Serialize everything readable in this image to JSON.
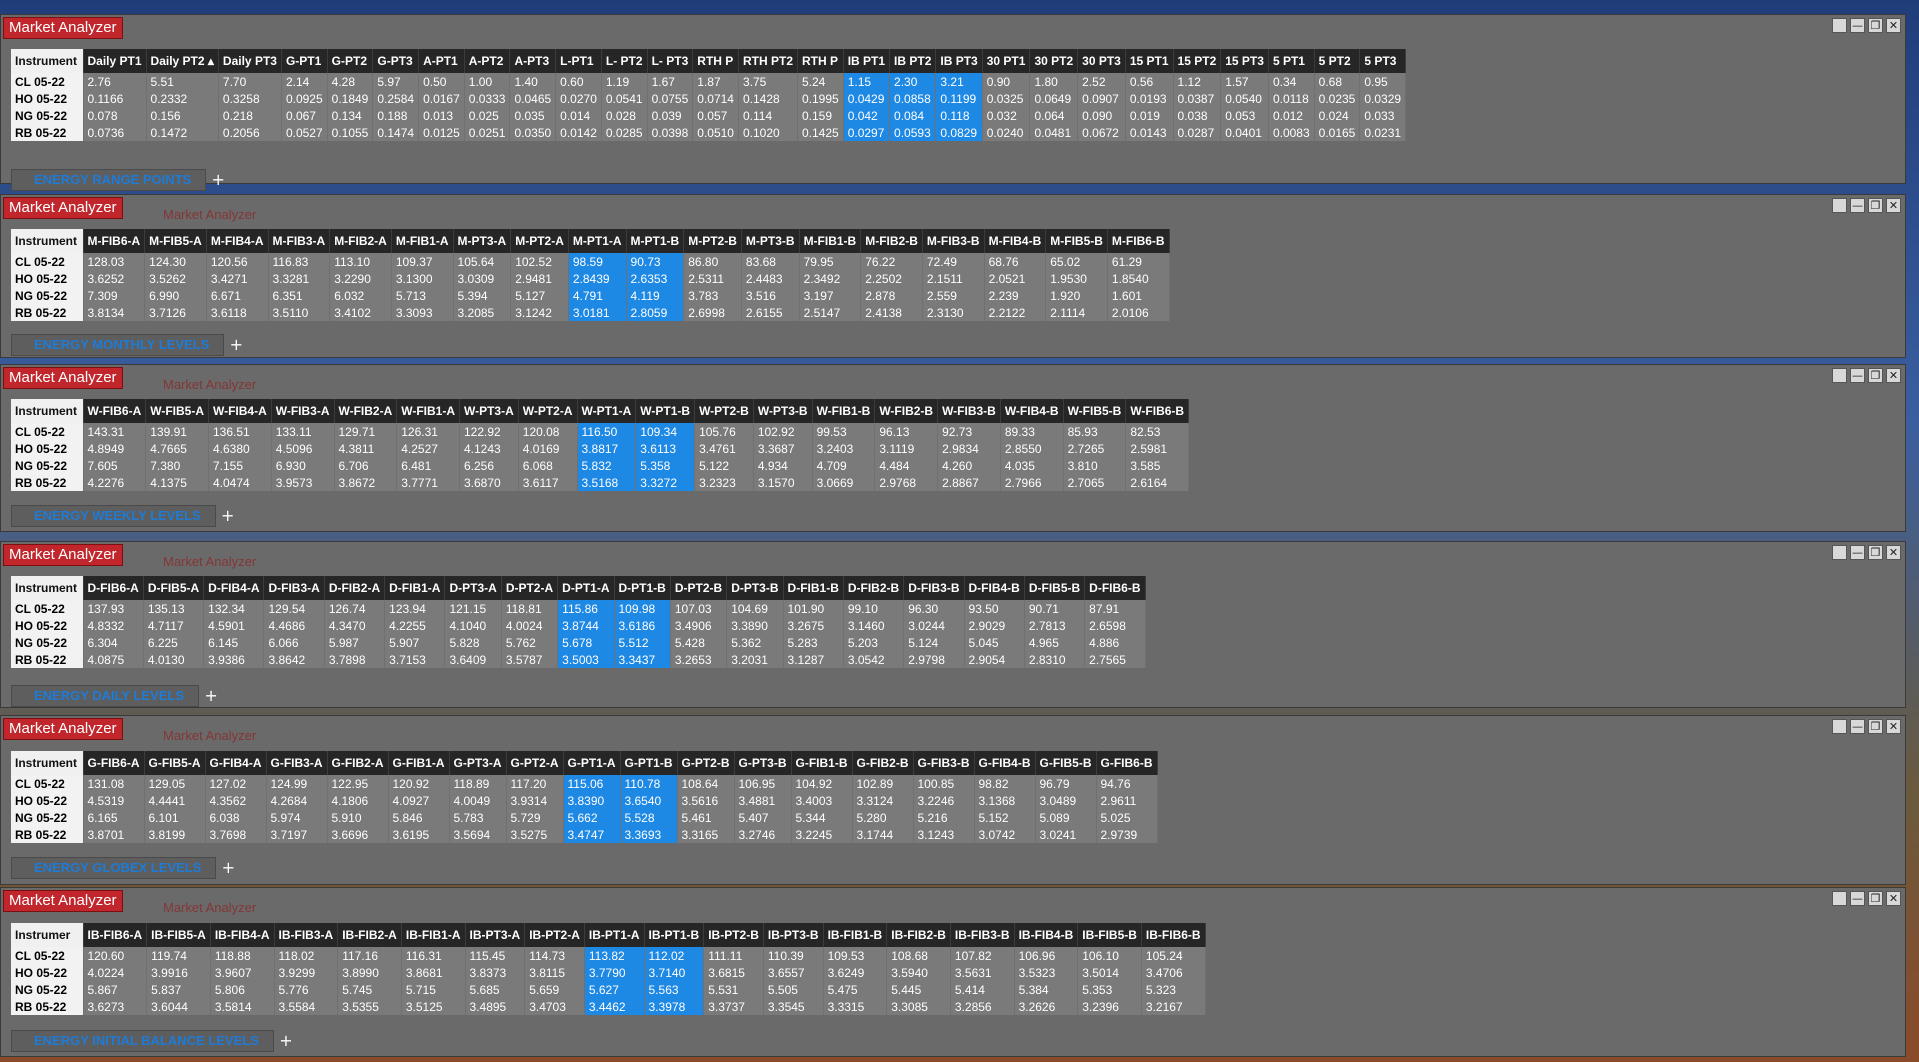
{
  "app": {
    "title": "Market Analyzer",
    "win_buttons": [
      "",
      "—",
      "❐",
      "✕"
    ]
  },
  "instruments": [
    "CL 05-22",
    "HO 05-22",
    "NG 05-22",
    "RB 05-22"
  ],
  "windows": [
    {
      "id": "range",
      "tab": "ENERGY RANGE POINTS",
      "instrument_header": "Instrument",
      "columns": [
        "Daily PT1",
        "Daily PT2 ▴",
        "Daily PT3",
        "G-PT1",
        "G-PT2",
        "G-PT3",
        "A-PT1",
        "A-PT2",
        "A-PT3",
        "L-PT1",
        "L- PT2",
        "L- PT3",
        "RTH P",
        "RTH PT2",
        "RTH P",
        "IB PT1",
        "IB PT2",
        "IB PT3",
        "30 PT1",
        "30 PT2",
        "30 PT3",
        "15 PT1",
        "15 PT2",
        "15 PT3",
        "5 PT1",
        "5 PT2",
        "5 PT3"
      ],
      "highlight": [
        15,
        16,
        17
      ],
      "rows": [
        [
          "2.76",
          "5.51",
          "7.70",
          "2.14",
          "4.28",
          "5.97",
          "0.50",
          "1.00",
          "1.40",
          "0.60",
          "1.19",
          "1.67",
          "1.87",
          "3.75",
          "5.24",
          "1.15",
          "2.30",
          "3.21",
          "0.90",
          "1.80",
          "2.52",
          "0.56",
          "1.12",
          "1.57",
          "0.34",
          "0.68",
          "0.95"
        ],
        [
          "0.1166",
          "0.2332",
          "0.3258",
          "0.0925",
          "0.1849",
          "0.2584",
          "0.0167",
          "0.0333",
          "0.0465",
          "0.0270",
          "0.0541",
          "0.0755",
          "0.0714",
          "0.1428",
          "0.1995",
          "0.0429",
          "0.0858",
          "0.1199",
          "0.0325",
          "0.0649",
          "0.0907",
          "0.0193",
          "0.0387",
          "0.0540",
          "0.0118",
          "0.0235",
          "0.0329"
        ],
        [
          "0.078",
          "0.156",
          "0.218",
          "0.067",
          "0.134",
          "0.188",
          "0.013",
          "0.025",
          "0.035",
          "0.014",
          "0.028",
          "0.039",
          "0.057",
          "0.114",
          "0.159",
          "0.042",
          "0.084",
          "0.118",
          "0.032",
          "0.064",
          "0.090",
          "0.019",
          "0.038",
          "0.053",
          "0.012",
          "0.024",
          "0.033"
        ],
        [
          "0.0736",
          "0.1472",
          "0.2056",
          "0.0527",
          "0.1055",
          "0.1474",
          "0.0125",
          "0.0251",
          "0.0350",
          "0.0142",
          "0.0285",
          "0.0398",
          "0.0510",
          "0.1020",
          "0.1425",
          "0.0297",
          "0.0593",
          "0.0829",
          "0.0240",
          "0.0481",
          "0.0672",
          "0.0143",
          "0.0287",
          "0.0401",
          "0.0083",
          "0.0165",
          "0.0231"
        ]
      ]
    },
    {
      "id": "monthly",
      "tab": "ENERGY MONTHLY LEVELS",
      "instrument_header": "Instrument",
      "columns": [
        "M-FIB6-A",
        "M-FIB5-A",
        "M-FIB4-A",
        "M-FIB3-A",
        "M-FIB2-A",
        "M-FIB1-A",
        "M-PT3-A",
        "M-PT2-A",
        "M-PT1-A",
        "M-PT1-B",
        "M-PT2-B",
        "M-PT3-B",
        "M-FIB1-B",
        "M-FIB2-B",
        "M-FIB3-B",
        "M-FIB4-B",
        "M-FIB5-B",
        "M-FIB6-B"
      ],
      "highlight": [
        8,
        9
      ],
      "rows": [
        [
          "128.03",
          "124.30",
          "120.56",
          "116.83",
          "113.10",
          "109.37",
          "105.64",
          "102.52",
          "98.59",
          "90.73",
          "86.80",
          "83.68",
          "79.95",
          "76.22",
          "72.49",
          "68.76",
          "65.02",
          "61.29"
        ],
        [
          "3.6252",
          "3.5262",
          "3.4271",
          "3.3281",
          "3.2290",
          "3.1300",
          "3.0309",
          "2.9481",
          "2.8439",
          "2.6353",
          "2.5311",
          "2.4483",
          "2.3492",
          "2.2502",
          "2.1511",
          "2.0521",
          "1.9530",
          "1.8540"
        ],
        [
          "7.309",
          "6.990",
          "6.671",
          "6.351",
          "6.032",
          "5.713",
          "5.394",
          "5.127",
          "4.791",
          "4.119",
          "3.783",
          "3.516",
          "3.197",
          "2.878",
          "2.559",
          "2.239",
          "1.920",
          "1.601"
        ],
        [
          "3.8134",
          "3.7126",
          "3.6118",
          "3.5110",
          "3.4102",
          "3.3093",
          "3.2085",
          "3.1242",
          "3.0181",
          "2.8059",
          "2.6998",
          "2.6155",
          "2.5147",
          "2.4138",
          "2.3130",
          "2.2122",
          "2.1114",
          "2.0106"
        ]
      ]
    },
    {
      "id": "weekly",
      "tab": "ENERGY WEEKLY LEVELS",
      "instrument_header": "Instrument",
      "columns": [
        "W-FIB6-A",
        "W-FIB5-A",
        "W-FIB4-A",
        "W-FIB3-A",
        "W-FIB2-A",
        "W-FIB1-A",
        "W-PT3-A",
        "W-PT2-A",
        "W-PT1-A",
        "W-PT1-B",
        "W-PT2-B",
        "W-PT3-B",
        "W-FIB1-B",
        "W-FIB2-B",
        "W-FIB3-B",
        "W-FIB4-B",
        "W-FIB5-B",
        "W-FIB6-B"
      ],
      "highlight": [
        8,
        9
      ],
      "rows": [
        [
          "143.31",
          "139.91",
          "136.51",
          "133.11",
          "129.71",
          "126.31",
          "122.92",
          "120.08",
          "116.50",
          "109.34",
          "105.76",
          "102.92",
          "99.53",
          "96.13",
          "92.73",
          "89.33",
          "85.93",
          "82.53"
        ],
        [
          "4.8949",
          "4.7665",
          "4.6380",
          "4.5096",
          "4.3811",
          "4.2527",
          "4.1243",
          "4.0169",
          "3.8817",
          "3.6113",
          "3.4761",
          "3.3687",
          "3.2403",
          "3.1119",
          "2.9834",
          "2.8550",
          "2.7265",
          "2.5981"
        ],
        [
          "7.605",
          "7.380",
          "7.155",
          "6.930",
          "6.706",
          "6.481",
          "6.256",
          "6.068",
          "5.832",
          "5.358",
          "5.122",
          "4.934",
          "4.709",
          "4.484",
          "4.260",
          "4.035",
          "3.810",
          "3.585"
        ],
        [
          "4.2276",
          "4.1375",
          "4.0474",
          "3.9573",
          "3.8672",
          "3.7771",
          "3.6870",
          "3.6117",
          "3.5168",
          "3.3272",
          "3.2323",
          "3.1570",
          "3.0669",
          "2.9768",
          "2.8867",
          "2.7966",
          "2.7065",
          "2.6164"
        ]
      ]
    },
    {
      "id": "daily",
      "tab": "ENERGY DAILY LEVELS",
      "instrument_header": "Instrument",
      "columns": [
        "D-FIB6-A",
        "D-FIB5-A",
        "D-FIB4-A",
        "D-FIB3-A",
        "D-FIB2-A",
        "D-FIB1-A",
        "D-PT3-A",
        "D-PT2-A",
        "D-PT1-A",
        "D-PT1-B",
        "D-PT2-B",
        "D-PT3-B",
        "D-FIB1-B",
        "D-FIB2-B",
        "D-FIB3-B",
        "D-FIB4-B",
        "D-FIB5-B",
        "D-FIB6-B"
      ],
      "highlight": [
        8,
        9
      ],
      "rows": [
        [
          "137.93",
          "135.13",
          "132.34",
          "129.54",
          "126.74",
          "123.94",
          "121.15",
          "118.81",
          "115.86",
          "109.98",
          "107.03",
          "104.69",
          "101.90",
          "99.10",
          "96.30",
          "93.50",
          "90.71",
          "87.91"
        ],
        [
          "4.8332",
          "4.7117",
          "4.5901",
          "4.4686",
          "4.3470",
          "4.2255",
          "4.1040",
          "4.0024",
          "3.8744",
          "3.6186",
          "3.4906",
          "3.3890",
          "3.2675",
          "3.1460",
          "3.0244",
          "2.9029",
          "2.7813",
          "2.6598"
        ],
        [
          "6.304",
          "6.225",
          "6.145",
          "6.066",
          "5.987",
          "5.907",
          "5.828",
          "5.762",
          "5.678",
          "5.512",
          "5.428",
          "5.362",
          "5.283",
          "5.203",
          "5.124",
          "5.045",
          "4.965",
          "4.886"
        ],
        [
          "4.0875",
          "4.0130",
          "3.9386",
          "3.8642",
          "3.7898",
          "3.7153",
          "3.6409",
          "3.5787",
          "3.5003",
          "3.3437",
          "3.2653",
          "3.2031",
          "3.1287",
          "3.0542",
          "2.9798",
          "2.9054",
          "2.8310",
          "2.7565"
        ]
      ]
    },
    {
      "id": "globex",
      "tab": "ENERGY GLOBEX LEVELS",
      "instrument_header": "Instrument",
      "columns": [
        "G-FIB6-A",
        "G-FIB5-A",
        "G-FIB4-A",
        "G-FIB3-A",
        "G-FIB2-A",
        "G-FIB1-A",
        "G-PT3-A",
        "G-PT2-A",
        "G-PT1-A",
        "G-PT1-B",
        "G-PT2-B",
        "G-PT3-B",
        "G-FIB1-B",
        "G-FIB2-B",
        "G-FIB3-B",
        "G-FIB4-B",
        "G-FIB5-B",
        "G-FIB6-B"
      ],
      "highlight": [
        8,
        9
      ],
      "rows": [
        [
          "131.08",
          "129.05",
          "127.02",
          "124.99",
          "122.95",
          "120.92",
          "118.89",
          "117.20",
          "115.06",
          "110.78",
          "108.64",
          "106.95",
          "104.92",
          "102.89",
          "100.85",
          "98.82",
          "96.79",
          "94.76"
        ],
        [
          "4.5319",
          "4.4441",
          "4.3562",
          "4.2684",
          "4.1806",
          "4.0927",
          "4.0049",
          "3.9314",
          "3.8390",
          "3.6540",
          "3.5616",
          "3.4881",
          "3.4003",
          "3.3124",
          "3.2246",
          "3.1368",
          "3.0489",
          "2.9611"
        ],
        [
          "6.165",
          "6.101",
          "6.038",
          "5.974",
          "5.910",
          "5.846",
          "5.783",
          "5.729",
          "5.662",
          "5.528",
          "5.461",
          "5.407",
          "5.344",
          "5.280",
          "5.216",
          "5.152",
          "5.089",
          "5.025"
        ],
        [
          "3.8701",
          "3.8199",
          "3.7698",
          "3.7197",
          "3.6696",
          "3.6195",
          "3.5694",
          "3.5275",
          "3.4747",
          "3.3693",
          "3.3165",
          "3.2746",
          "3.2245",
          "3.1744",
          "3.1243",
          "3.0742",
          "3.0241",
          "2.9739"
        ]
      ]
    },
    {
      "id": "ib",
      "tab": "ENERGY INITIAL BALANCE LEVELS",
      "instrument_header": "Instrumer",
      "columns": [
        "IB-FIB6-A",
        "IB-FIB5-A",
        "IB-FIB4-A",
        "IB-FIB3-A",
        "IB-FIB2-A",
        "IB-FIB1-A",
        "IB-PT3-A",
        "IB-PT2-A",
        "IB-PT1-A",
        "IB-PT1-B",
        "IB-PT2-B",
        "IB-PT3-B",
        "IB-FIB1-B",
        "IB-FIB2-B",
        "IB-FIB3-B",
        "IB-FIB4-B",
        "IB-FIB5-B",
        "IB-FIB6-B"
      ],
      "highlight": [
        8,
        9
      ],
      "rows": [
        [
          "120.60",
          "119.74",
          "118.88",
          "118.02",
          "117.16",
          "116.31",
          "115.45",
          "114.73",
          "113.82",
          "112.02",
          "111.11",
          "110.39",
          "109.53",
          "108.68",
          "107.82",
          "106.96",
          "106.10",
          "105.24"
        ],
        [
          "4.0224",
          "3.9916",
          "3.9607",
          "3.9299",
          "3.8990",
          "3.8681",
          "3.8373",
          "3.8115",
          "3.7790",
          "3.7140",
          "3.6815",
          "3.6557",
          "3.6249",
          "3.5940",
          "3.5631",
          "3.5323",
          "3.5014",
          "3.4706"
        ],
        [
          "5.867",
          "5.837",
          "5.806",
          "5.776",
          "5.745",
          "5.715",
          "5.685",
          "5.659",
          "5.627",
          "5.563",
          "5.531",
          "5.505",
          "5.475",
          "5.445",
          "5.414",
          "5.384",
          "5.353",
          "5.323"
        ],
        [
          "3.6273",
          "3.6044",
          "3.5814",
          "3.5584",
          "3.5355",
          "3.5125",
          "3.4895",
          "3.4703",
          "3.4462",
          "3.3978",
          "3.3737",
          "3.3545",
          "3.3315",
          "3.3085",
          "3.2856",
          "3.2626",
          "3.2396",
          "3.2167"
        ]
      ]
    }
  ]
}
